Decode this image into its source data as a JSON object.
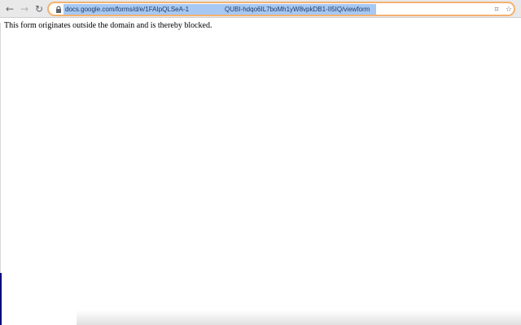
{
  "browser": {
    "url": {
      "visible_left": "docs.google.com/forms/d/e/1FAIpQLSeA-1",
      "visible_right": "QUBI-hdqo6IL7boMh1yW8vpkDB1-II5IQ/viewform"
    },
    "icons": {
      "back": "back-arrow-icon",
      "forward": "forward-arrow-icon",
      "reload": "reload-icon",
      "lock": "lock-icon",
      "qr": "qr-code-icon",
      "star": "bookmark-star-icon"
    },
    "accent_color": "#f4b26f",
    "selection_color": "#a7c8f2"
  },
  "page": {
    "message": "This form originates outside the domain and is thereby blocked."
  }
}
